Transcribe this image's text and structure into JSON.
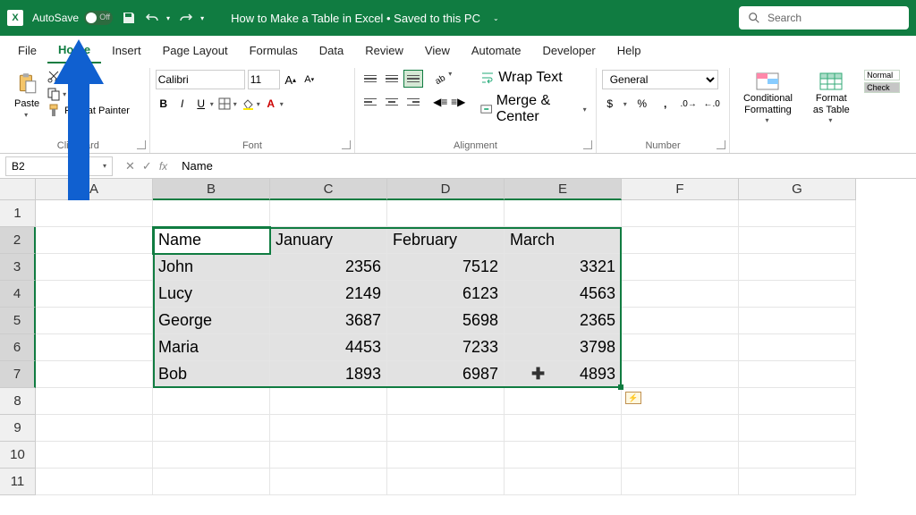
{
  "titlebar": {
    "autosave_label": "AutoSave",
    "autosave_state": "Off",
    "title": "How to Make a Table in Excel • Saved to this PC",
    "search_placeholder": "Search"
  },
  "tabs": [
    "File",
    "Home",
    "Insert",
    "Page Layout",
    "Formulas",
    "Data",
    "Review",
    "View",
    "Automate",
    "Developer",
    "Help"
  ],
  "active_tab": "Home",
  "ribbon": {
    "clipboard": {
      "label": "Clipboard",
      "paste": "Paste",
      "cut": "Cut",
      "copy": "Copy",
      "painter": "Format Painter"
    },
    "font": {
      "label": "Font",
      "name": "Calibri",
      "size": "11"
    },
    "alignment": {
      "label": "Alignment",
      "wrap": "Wrap Text",
      "merge": "Merge & Center"
    },
    "number": {
      "label": "Number",
      "format": "General"
    },
    "styles": {
      "cond": "Conditional Formatting",
      "table": "Format as Table",
      "normal": "Normal",
      "check": "Check"
    }
  },
  "fbar": {
    "name_box": "B2",
    "formula": "Name"
  },
  "columns": [
    "A",
    "B",
    "C",
    "D",
    "E",
    "F",
    "G"
  ],
  "selected_cols": [
    "B",
    "C",
    "D",
    "E"
  ],
  "row_count": 11,
  "selected_rows": [
    2,
    3,
    4,
    5,
    6,
    7
  ],
  "active_cell": "B2",
  "cells": {
    "B2": "Name",
    "C2": "January",
    "D2": "February",
    "E2": "March",
    "B3": "John",
    "C3": "2356",
    "D3": "7512",
    "E3": "3321",
    "B4": "Lucy",
    "C4": "2149",
    "D4": "6123",
    "E4": "4563",
    "B5": "George",
    "C5": "3687",
    "D5": "5698",
    "E5": "2365",
    "B6": "Maria",
    "C6": "4453",
    "D6": "7233",
    "E6": "3798",
    "B7": "Bob",
    "C7": "1893",
    "D7": "6987",
    "E7": "4893"
  },
  "numeric_cols": [
    "C",
    "D",
    "E"
  ],
  "numeric_header_row": 2,
  "icons": {
    "save": "save-icon",
    "undo": "undo-icon",
    "redo": "redo-icon"
  }
}
